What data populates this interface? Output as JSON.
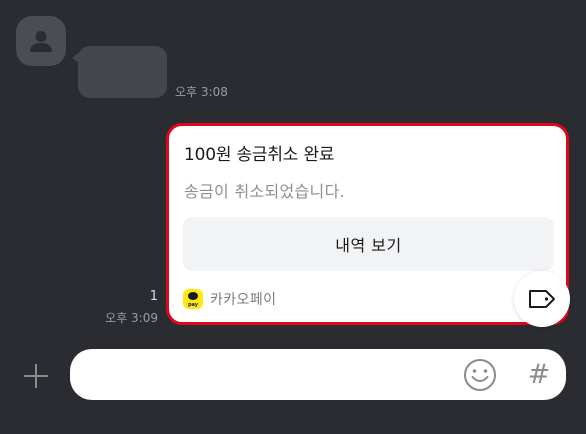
{
  "chat": {
    "incoming_time": "오후 3:08",
    "outgoing_unread": "1",
    "outgoing_time": "오후 3:09"
  },
  "card": {
    "title": "100원 송금취소 완료",
    "subtitle": "송금이 취소되었습니다.",
    "button_label": "내역 보기",
    "brand_label": "카카오페이",
    "logo_text": "pay"
  },
  "input": {
    "placeholder": "",
    "hash_symbol": "#"
  },
  "colors": {
    "background": "#2a2c31",
    "card_highlight": "#e0061b",
    "pay_yellow": "#ffe812"
  },
  "icons": {
    "avatar": "person-icon",
    "share": "tag-icon",
    "plus": "plus-icon",
    "emoji": "smiley-icon"
  }
}
